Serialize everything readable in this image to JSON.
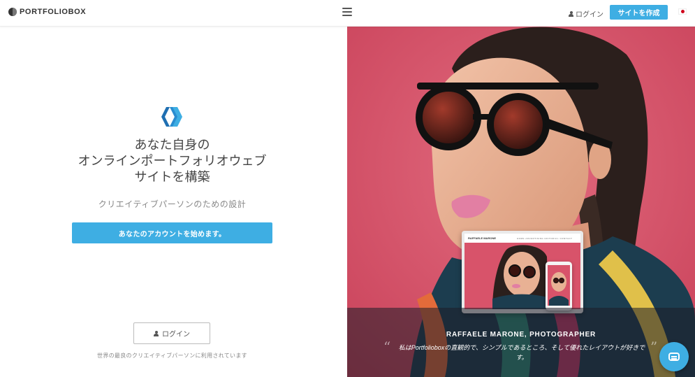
{
  "header": {
    "logo_text": "PORTFOLIOBOX",
    "login_label": "ログイン",
    "cta_label": "サイトを作成"
  },
  "hero": {
    "headline_lines": [
      "あなた自身の",
      "オンラインポートフォリオウェブ",
      "サイトを構築"
    ],
    "subline": "クリエイティブパーソンのための設計",
    "start_button": "あなたのアカウントを始めます。",
    "login_button": "ログイン",
    "footer_note": "世界の最良のクリエイティブパーソンに利用されています"
  },
  "showcase": {
    "photographer": "RAFFAELE MARONE, PHOTOGRAPHER",
    "quote": "私はPortfolioboxの直観的で、シンプルであるところ、そして優れたレイアウトが好きです。",
    "mock_site_title": "RAFFAELE MARONE",
    "mock_site_links": "HOME   ADVERTISING   EDITORIAL   CONTACT"
  },
  "colors": {
    "accent": "#3eaee3",
    "photo_background": "#d8536a"
  }
}
